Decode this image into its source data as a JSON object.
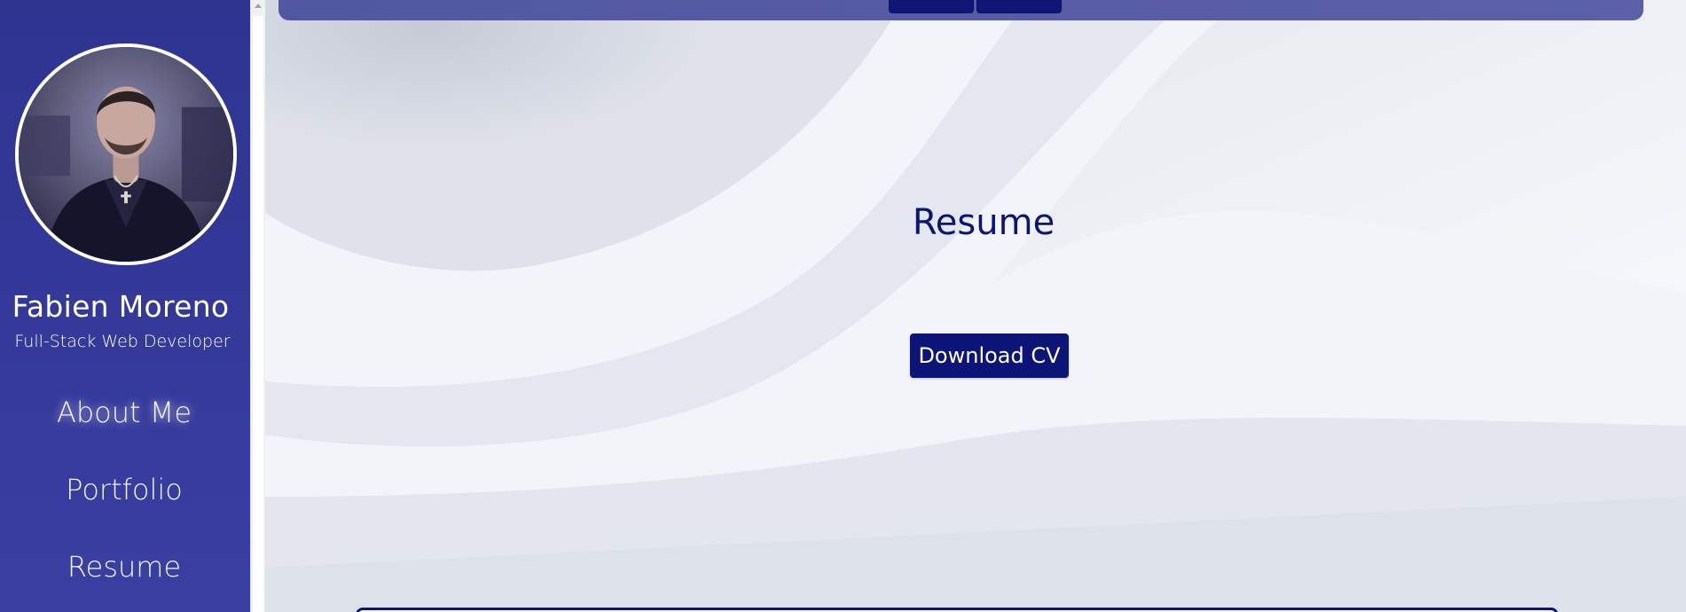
{
  "profile": {
    "name": "Fabien Moreno",
    "role": "Full-Stack Web Developer"
  },
  "nav": {
    "items": [
      {
        "label": "About Me"
      },
      {
        "label": "Portfolio"
      },
      {
        "label": "Resume"
      }
    ]
  },
  "resume": {
    "title": "Resume",
    "download_label": "Download CV"
  },
  "colors": {
    "sidebar": "#2e3490",
    "accent": "#0c1478",
    "topbar": "#5157a0"
  }
}
